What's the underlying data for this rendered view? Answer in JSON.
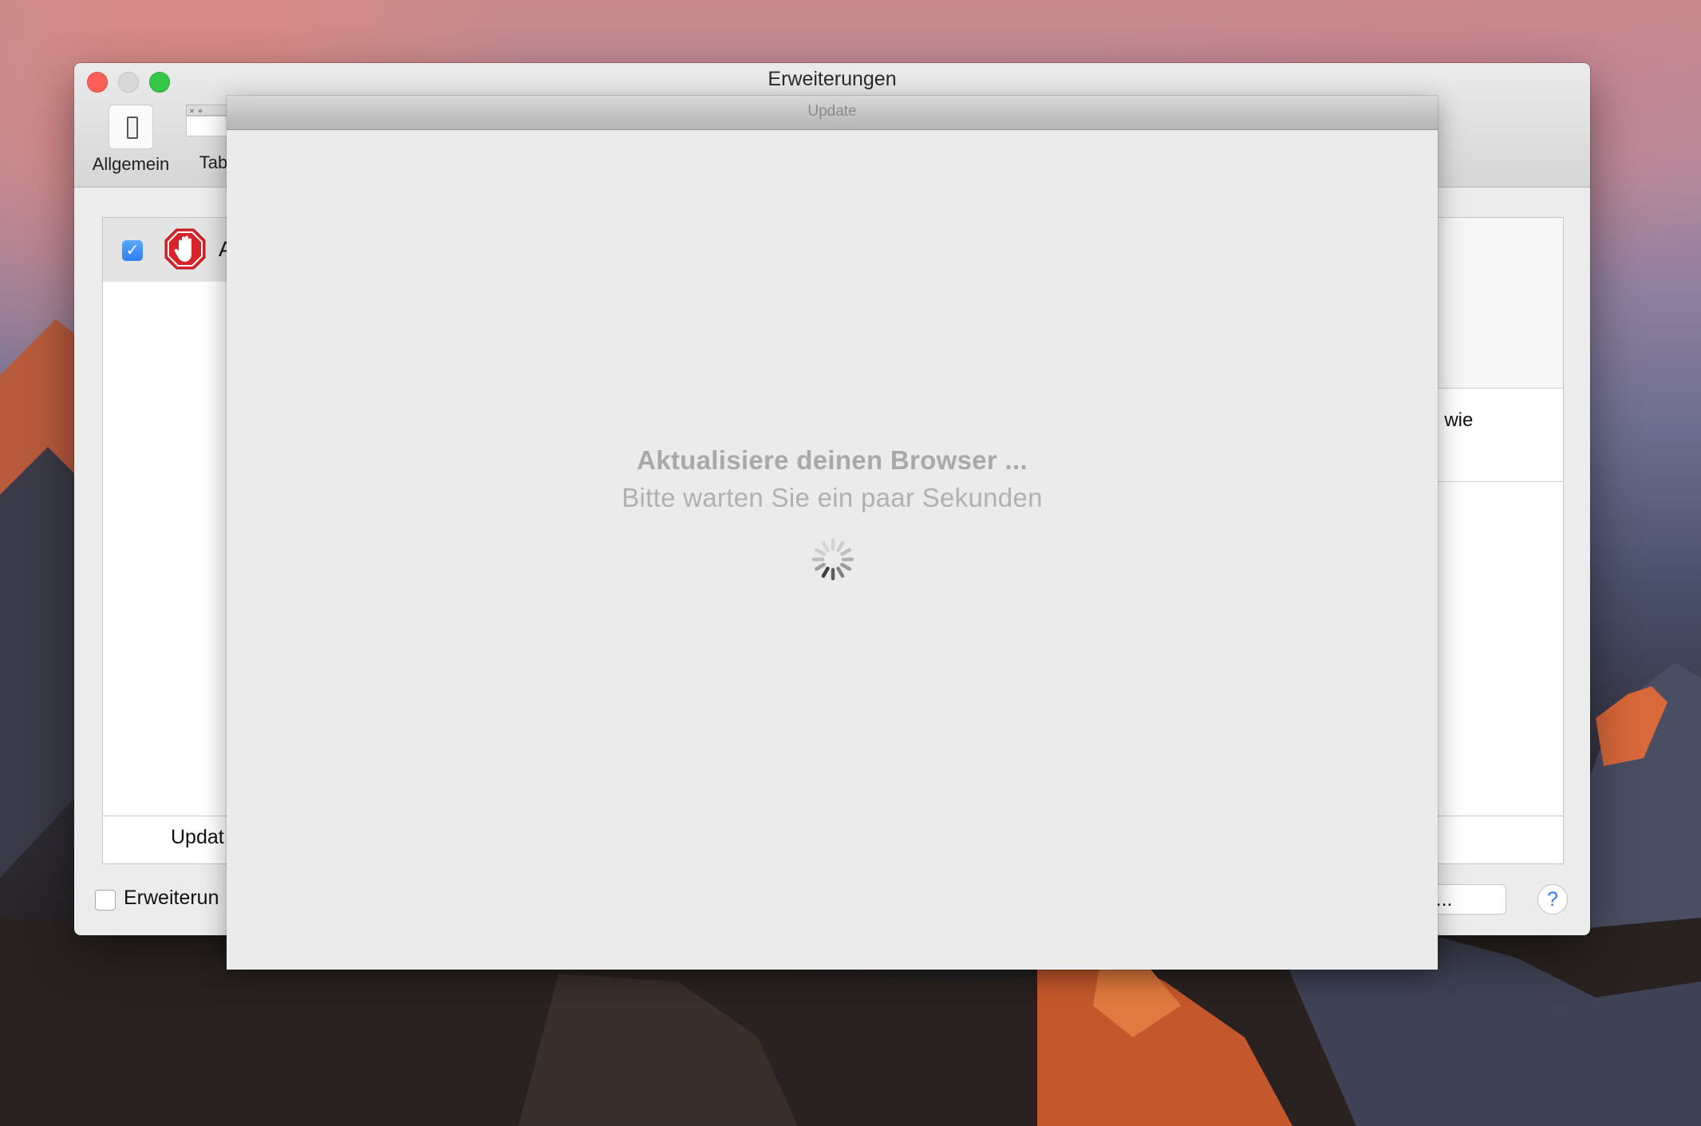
{
  "main_window": {
    "title": "Erweiterungen",
    "toolbar": [
      {
        "label": "Allgemein",
        "icon": "switch-icon"
      },
      {
        "label": "Tabs",
        "icon": "tabs-icon",
        "tab_glyphs": "× +"
      }
    ],
    "extension_row": {
      "checked": true,
      "name_fragment": "A",
      "icon": "adblock-hand-icon"
    },
    "update_label_fragment": "Updat",
    "right_text_fragment": ", wie",
    "bottom_checkbox_label_fragment": "Erweiterun",
    "more_button_label_fragment": "gen ...",
    "help_label": "?"
  },
  "update_dialog": {
    "title": "Update",
    "message_title": "Aktualisiere deinen Browser ...",
    "message_subtitle": "Bitte warten Sie ein paar Sekunden",
    "spinner": "loading-spinner"
  },
  "colors": {
    "close": "#fc5f57",
    "minimize": "#d8d8d8",
    "zoom": "#34c748",
    "checkbox_accent": "#2f7ef3",
    "help_accent": "#2d7cf6"
  }
}
